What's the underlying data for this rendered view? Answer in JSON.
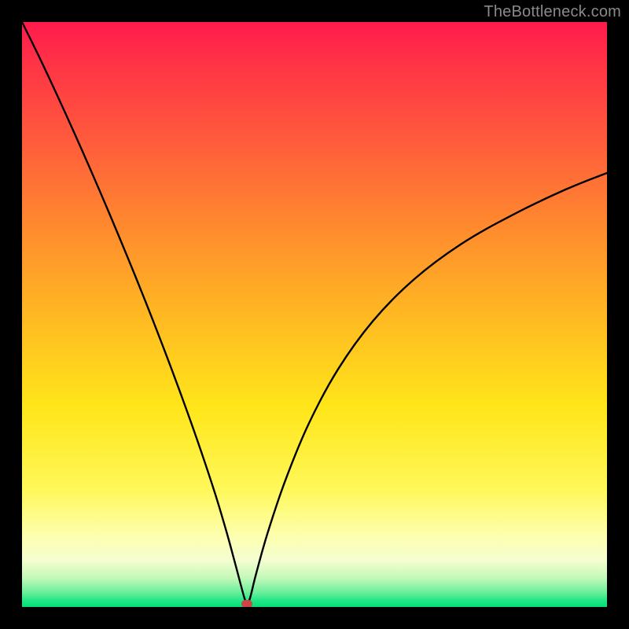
{
  "watermark": "TheBottleneck.com",
  "colors": {
    "frame": "#000000",
    "curve": "#000000",
    "marker": "#cf4545",
    "gradient_top": "#ff1a4d",
    "gradient_bottom": "#06dd78"
  },
  "chart_data": {
    "type": "line",
    "title": "",
    "xlabel": "",
    "ylabel": "",
    "xlim": [
      0,
      100
    ],
    "ylim": [
      0,
      100
    ],
    "grid": false,
    "legend": false,
    "marker": {
      "x": 38.5,
      "y": 0.6
    },
    "series": [
      {
        "name": "curve",
        "x": [
          0,
          3,
          6,
          9,
          12,
          15,
          18,
          21,
          24,
          27,
          30,
          33,
          35,
          36.5,
          38,
          38.5,
          39,
          40,
          42,
          45,
          49,
          54,
          60,
          67,
          75,
          84,
          93,
          100
        ],
        "y": [
          100,
          93.9,
          87.5,
          80.9,
          74.1,
          67.1,
          59.9,
          52.5,
          44.8,
          36.8,
          28.4,
          19.4,
          12.7,
          7.2,
          1.6,
          0.6,
          1.6,
          5.6,
          12.7,
          21.6,
          31.3,
          40.6,
          48.9,
          56.0,
          62.0,
          67.1,
          71.4,
          74.2
        ]
      }
    ]
  }
}
